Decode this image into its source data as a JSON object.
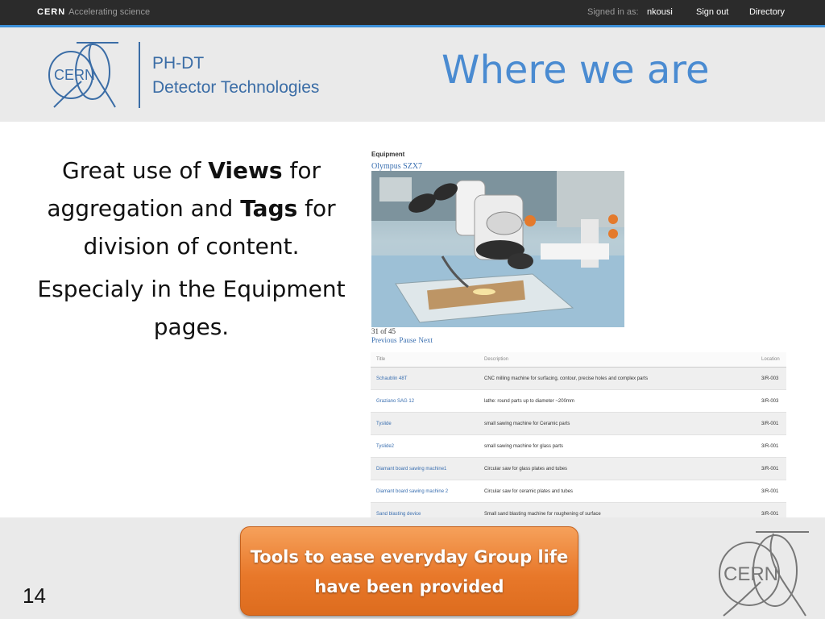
{
  "topbar": {
    "brand": "CERN",
    "tagline": "Accelerating science",
    "signed_in_label": "Signed in as:",
    "username": "nkousi",
    "sign_out": "Sign out",
    "directory": "Directory"
  },
  "header": {
    "logo_text": "CERN",
    "dept_line1": "PH-DT",
    "dept_line2": "Detector Technologies",
    "slide_title": "Where we are"
  },
  "body": {
    "para1_part1": "Great use of ",
    "para1_bold1": "Views",
    "para1_part2": " for aggregation and ",
    "para1_bold2": "Tags",
    "para1_part3": " for division of content.",
    "para2": "Especialy in the Equipment pages."
  },
  "inset": {
    "section_label": "Equipment",
    "equipment_name": "Olympus SZX7",
    "counter": "31 of 45",
    "nav_prev": "Previous",
    "nav_pause": "Pause",
    "nav_next": "Next",
    "table": {
      "headers": [
        "Title",
        "Description",
        "Location"
      ],
      "rows": [
        {
          "title": "Schaublin 48T",
          "description": "CNC milling machine for surfacing, contour, precise holes and complex parts",
          "location": "3/R-003"
        },
        {
          "title": "Graziano SAG 12",
          "description": "lathe: round parts up to diameter ~200mm",
          "location": "3/R-003"
        },
        {
          "title": "Tyslide",
          "description": "small sawing machine for Ceramic parts",
          "location": "3/R-001"
        },
        {
          "title": "Tyslide2",
          "description": "small sawing machine for glass parts",
          "location": "3/R-001"
        },
        {
          "title": "Diamant board sawing machine1",
          "description": "Circular saw for glass plates and tubes",
          "location": "3/R-001"
        },
        {
          "title": "Diamant board sawing machine 2",
          "description": "Circular saw for ceramic plates and tubes",
          "location": "3/R-001"
        },
        {
          "title": "Sand blasting device",
          "description": "Small sand blasting machine for roughening of surface",
          "location": "3/R-001"
        }
      ]
    }
  },
  "footer": {
    "page_number": "14",
    "callout_line1": "Tools to ease everyday Group life",
    "callout_line2": "have been provided",
    "logo_text": "CERN"
  },
  "colors": {
    "accent_blue": "#4a8bd1",
    "topbar_bg": "#2b2b2b",
    "callout_orange": "#e8782a",
    "header_bg": "#eaeaea"
  }
}
